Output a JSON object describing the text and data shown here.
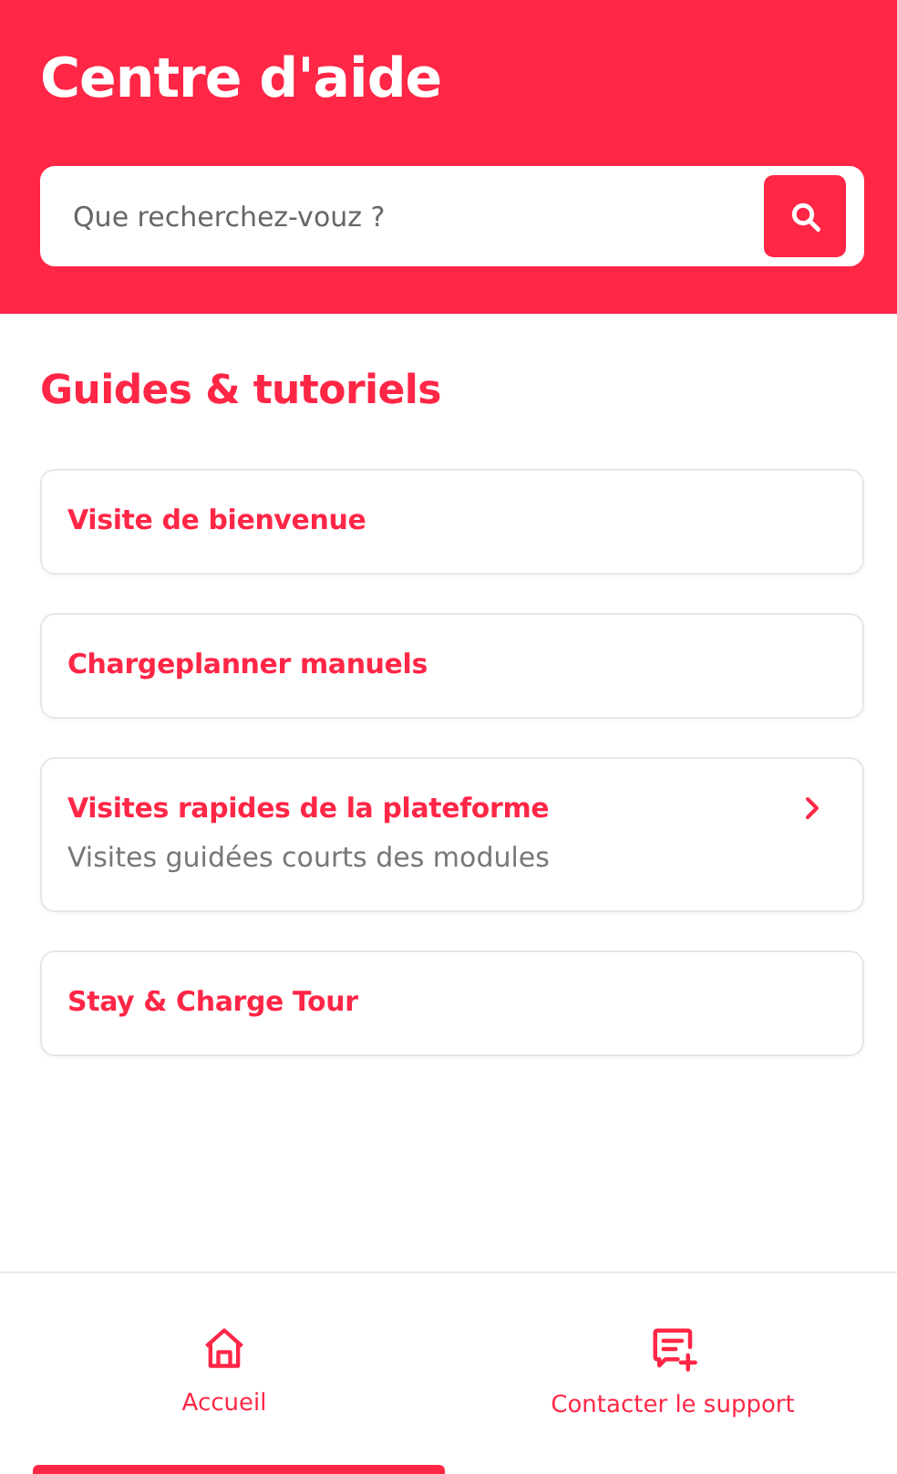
{
  "header": {
    "title": "Centre d'aide"
  },
  "search": {
    "placeholder": "Que recherchez-vouz ?"
  },
  "section": {
    "title": "Guides & tutoriels"
  },
  "guides": [
    {
      "title": "Visite de bienvenue",
      "chevron": false
    },
    {
      "title": "Chargeplanner manuels",
      "chevron": false
    },
    {
      "title": "Visites rapides de la plateforme",
      "subtitle": "Visites guidées courts des modules",
      "chevron": true
    },
    {
      "title": "Stay & Charge Tour",
      "chevron": false
    }
  ],
  "nav": [
    {
      "label": "Accueil",
      "kind": "home",
      "selected": true
    },
    {
      "label": "Contacter le support",
      "kind": "chat",
      "selected": false
    }
  ]
}
